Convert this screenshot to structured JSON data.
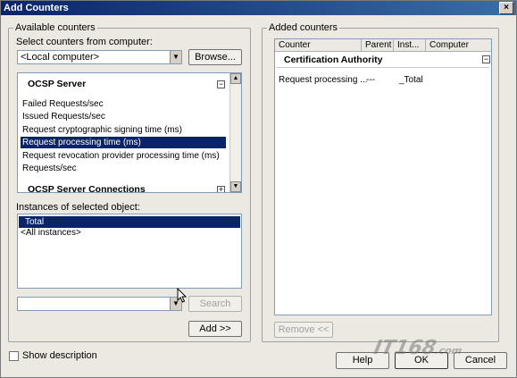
{
  "window": {
    "title": "Add Counters",
    "close_icon": "×"
  },
  "left": {
    "group_title": "Available counters",
    "select_label": "Select counters from computer:",
    "computer_value": "<Local computer>",
    "browse_label": "Browse...",
    "counter_category": "OCSP Server",
    "collapse_symbol": "−",
    "counters": [
      "Failed Requests/sec",
      "Issued Requests/sec",
      "Request cryptographic signing time (ms)",
      "Request processing time (ms)",
      "Request revocation provider processing time (ms)",
      "Requests/sec"
    ],
    "selected_counter_index": 3,
    "next_category": "OCSP Server Connections",
    "expand_symbol": "+",
    "instances_label": "Instances of selected object:",
    "instances": [
      "Total",
      "<All instances>"
    ],
    "selected_instance_index": 0,
    "search_value": "",
    "search_label": "Search",
    "add_label": "Add >>"
  },
  "right": {
    "group_title": "Added counters",
    "columns": [
      "Counter",
      "Parent",
      "Inst...",
      "Computer"
    ],
    "object_name": "Certification Authority",
    "collapse_symbol": "−",
    "rows": [
      {
        "counter": "Request processing ...",
        "parent": "---",
        "instance": "_Total",
        "computer": ""
      }
    ],
    "remove_label": "Remove <<"
  },
  "footer": {
    "show_description_label": "Show description",
    "show_description_checked": false,
    "help_label": "Help",
    "ok_label": "OK",
    "cancel_label": "Cancel"
  },
  "watermark": {
    "main": "IT168",
    "sub": ".com"
  },
  "colors": {
    "selection": "#0a246a",
    "titlebar": "#0a246a",
    "dialog_bg": "#ece9e2"
  }
}
